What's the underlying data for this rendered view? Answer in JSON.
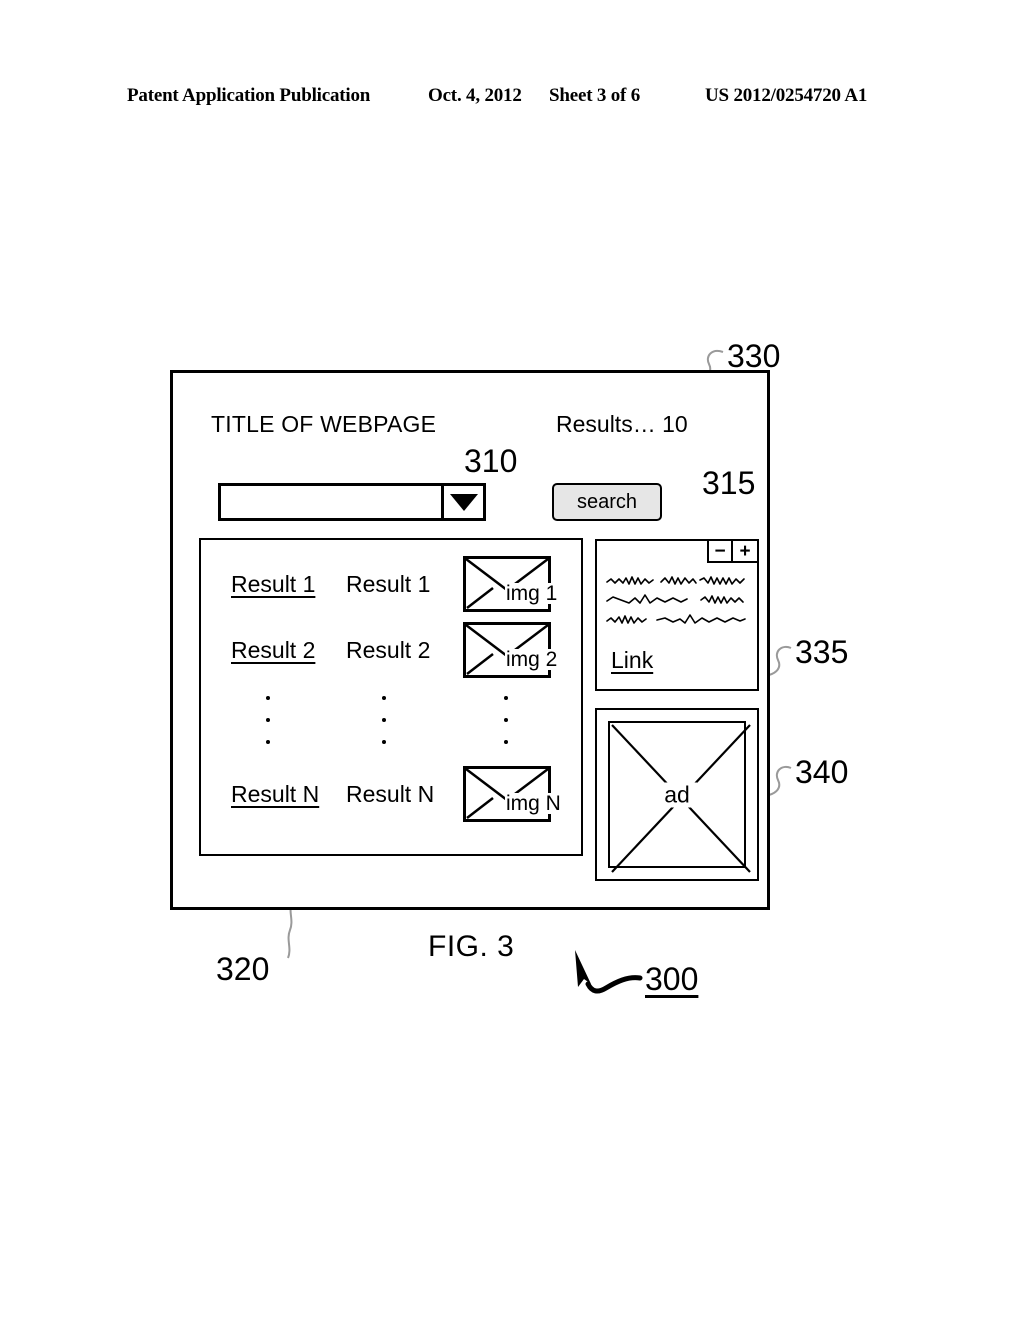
{
  "patent_header": {
    "publication": "Patent Application Publication",
    "date": "Oct. 4, 2012",
    "sheet": "Sheet 3 of 6",
    "number": "US 2012/0254720 A1"
  },
  "figure": {
    "caption": "FIG. 3",
    "system_ref": "300"
  },
  "browser_window": {
    "ref": "330",
    "page_title": "TITLE OF WEBPAGE",
    "results_count_label": "Results… 10"
  },
  "search": {
    "combobox_ref": "310",
    "combobox_value": "",
    "combobox_placeholder": "",
    "dropdown_icon": "triangle-down-icon",
    "button_ref": "315",
    "button_label": "search"
  },
  "results_list": {
    "ref": "320",
    "rows": [
      {
        "link": "Result 1",
        "text": "Result 1",
        "image_label": "img 1",
        "image_icon": "picture-placeholder-icon"
      },
      {
        "link": "Result 2",
        "text": "Result 2",
        "image_label": "img 2",
        "image_icon": "picture-placeholder-icon"
      },
      {
        "link": "Result N",
        "text": "Result N",
        "image_label": "img N",
        "image_icon": "picture-placeholder-icon"
      }
    ],
    "ellipsis_dots": 3
  },
  "widget_panel": {
    "ref": "335",
    "zoom_out_label": "−",
    "zoom_in_label": "+",
    "link_label": "Link",
    "squiggle_rows": 3
  },
  "ad_panel": {
    "ref": "340",
    "label": "ad",
    "icon": "image-placeholder-x-icon"
  },
  "colors": {
    "ink": "#000000",
    "paper": "#ffffff",
    "button_fill": "#e6e6e6",
    "leader_line": "#9a9a9a"
  }
}
